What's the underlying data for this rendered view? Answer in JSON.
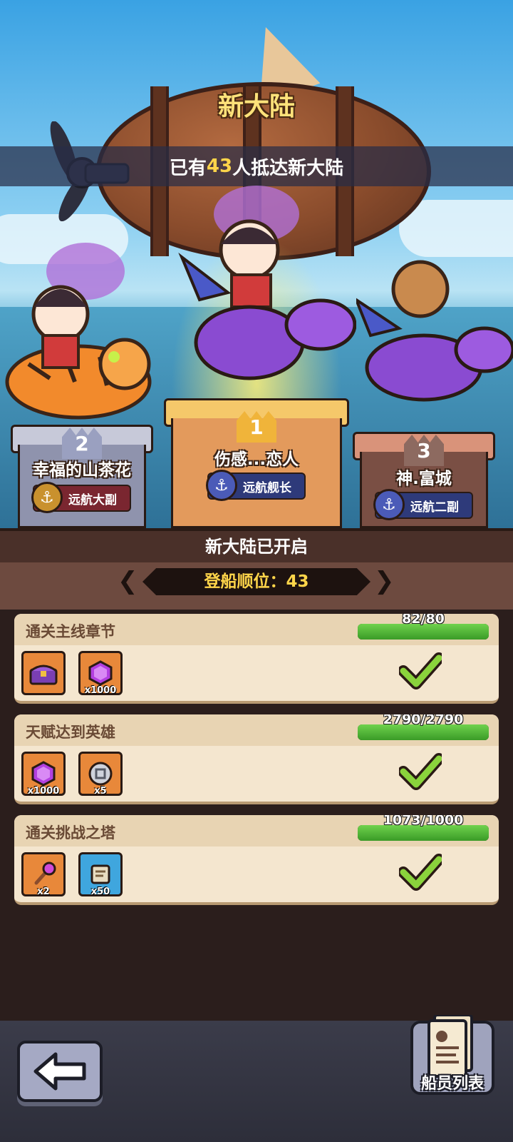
{
  "header": {
    "title": "新大陆",
    "arrived_prefix": "已有",
    "arrived_count": "43",
    "arrived_suffix": "人抵达新大陆"
  },
  "podium": [
    {
      "rank": "2",
      "name": "幸福的山茶花",
      "title": "远航大副",
      "mount": "tiger"
    },
    {
      "rank": "1",
      "name": "伤感...恋人",
      "title": "远航舰长",
      "mount": "purple-dragon"
    },
    {
      "rank": "3",
      "name": "神.富城",
      "title": "远航二副",
      "mount": "purple-dragon"
    }
  ],
  "section": {
    "heading": "新大陆已开启",
    "boarding_order_label": "登船顺位：",
    "boarding_order_value": "43"
  },
  "tasks": [
    {
      "label": "通关主线章节",
      "progress_text": "82/80",
      "progress": 1.0,
      "completed": true,
      "rewards": [
        {
          "icon": "treasure-chest-icon",
          "qty": ""
        },
        {
          "icon": "purple-gem-icon",
          "qty": "x1000"
        }
      ]
    },
    {
      "label": "天赋达到英雄",
      "progress_text": "2790/2790",
      "progress": 1.0,
      "completed": true,
      "rewards": [
        {
          "icon": "purple-gem-icon",
          "qty": "x1000"
        },
        {
          "icon": "silver-coin-icon",
          "qty": "x5"
        }
      ]
    },
    {
      "label": "通关挑战之塔",
      "progress_text": "1073/1000",
      "progress": 1.0,
      "completed": true,
      "rewards": [
        {
          "icon": "magic-staff-icon",
          "qty": "x2"
        },
        {
          "icon": "scroll-icon",
          "qty": "x50"
        }
      ]
    }
  ],
  "footer": {
    "back_icon": "back-arrow-icon",
    "crew_list_label": "船员列表"
  },
  "colors": {
    "accent_gold": "#ffd54a",
    "progress_green": "#4cb52f",
    "panel_bg": "#2b1e1c"
  }
}
